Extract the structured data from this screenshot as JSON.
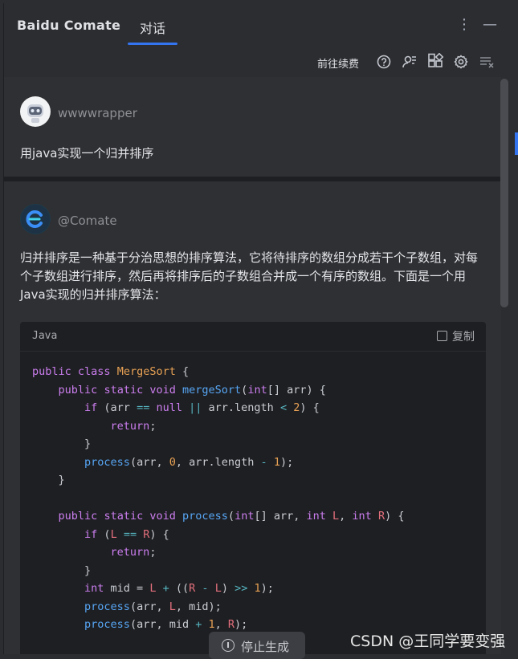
{
  "header": {
    "app_title": "Baidu Comate",
    "tab_label": "对话",
    "more_icon": "more-vertical-icon",
    "minimize_icon": "minimize-icon"
  },
  "toolbar": {
    "renew_label": "前往续费",
    "icons": [
      "help-icon",
      "user-search-icon",
      "plugins-icon",
      "settings-icon",
      "clear-chat-icon"
    ]
  },
  "messages": {
    "user": {
      "name": "wwwwrapper",
      "text": "用java实现一个归并排序"
    },
    "bot": {
      "name": "@Comate",
      "text": "归并排序是一种基于分治思想的排序算法，它将待排序的数组分成若干个子数组，对每个子数组进行排序，然后再将排序后的子数组合并成一个有序的数组。下面是一个用Java实现的归并排序算法：",
      "code": {
        "language": "Java",
        "copy_label": "复制",
        "lines": [
          "public class MergeSort {",
          "    public static void mergeSort(int[] arr) {",
          "        if (arr == null || arr.length < 2) {",
          "            return;",
          "        }",
          "        process(arr, 0, arr.length - 1);",
          "    }",
          "",
          "    public static void process(int[] arr, int L, int R) {",
          "        if (L == R) {",
          "            return;",
          "        }",
          "        int mid = L + ((R - L) >> 1);",
          "        process(arr, L, mid);",
          "        process(arr, mid + 1, R);"
        ]
      }
    }
  },
  "stop_button": "停止生成",
  "watermark": "CSDN @王同学要变强",
  "colors": {
    "accent": "#3574f0",
    "background": "#2b2d30",
    "code_background": "#1e1f22"
  }
}
